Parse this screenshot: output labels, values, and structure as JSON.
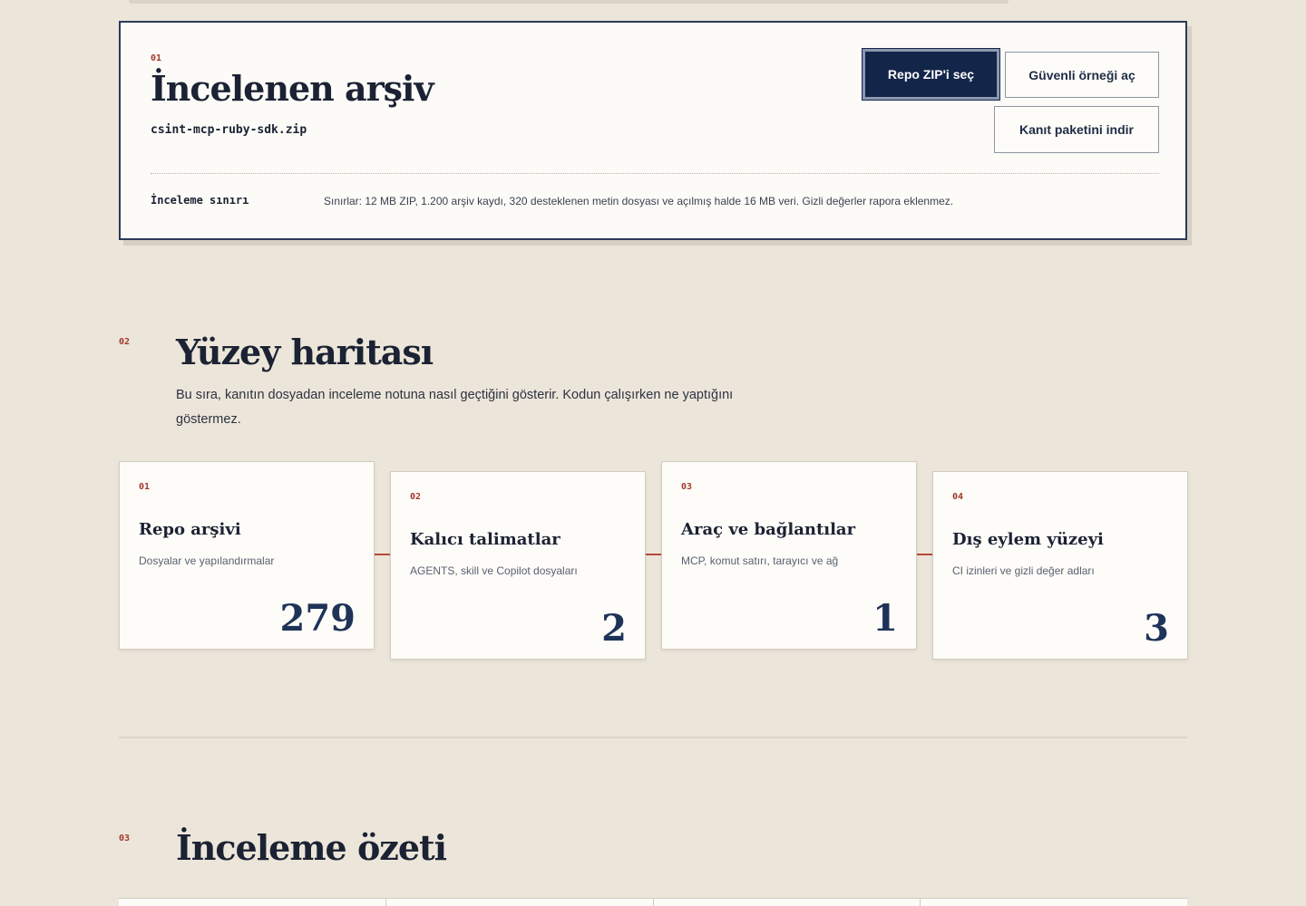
{
  "archive": {
    "step": "01",
    "title": "İncelenen arşiv",
    "file_name": "csint-mcp-ruby-sdk.zip",
    "buttons": {
      "select_zip": "Repo ZIP'i seç",
      "safe_example": "Güvenli örneği aç",
      "download_evidence": "Kanıt paketini indir"
    },
    "limit_label": "İnceleme sınırı",
    "limit_text": "Sınırlar: 12 MB ZIP, 1.200 arşiv kaydı, 320 desteklenen metin dosyası ve açılmış halde 16 MB veri. Gizli değerler rapora eklenmez."
  },
  "surface_map": {
    "step": "02",
    "title": "Yüzey haritası",
    "description": "Bu sıra, kanıtın dosyadan inceleme notuna nasıl geçtiğini gösterir. Kodun çalışırken ne yaptığını göstermez.",
    "cards": [
      {
        "step": "01",
        "title": "Repo arşivi",
        "subtitle": "Dosyalar ve yapılandırmalar",
        "value": "279"
      },
      {
        "step": "02",
        "title": "Kalıcı talimatlar",
        "subtitle": "AGENTS, skill ve Copilot dosyaları",
        "value": "2"
      },
      {
        "step": "03",
        "title": "Araç ve bağlantılar",
        "subtitle": "MCP, komut satırı, tarayıcı ve ağ",
        "value": "1"
      },
      {
        "step": "04",
        "title": "Dış eylem yüzeyi",
        "subtitle": "CI izinleri ve gizli değer adları",
        "value": "3"
      }
    ]
  },
  "review_summary": {
    "step": "03",
    "title": "İnceleme özeti"
  }
}
